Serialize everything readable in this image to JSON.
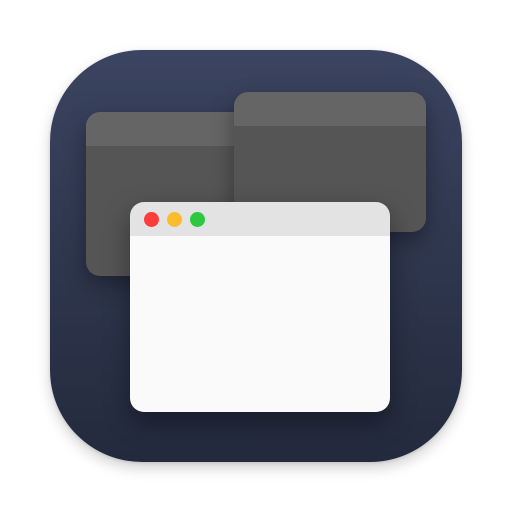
{
  "icon": {
    "semantic": "window-manager-app-icon",
    "colors": {
      "background_top": "#3b4460",
      "background_bottom": "#232a3d",
      "back_window_titlebar": "#656565",
      "back_window_body": "#555555",
      "front_window_titlebar": "#e3e3e3",
      "front_window_body": "#fafafa",
      "traffic_close": "#fc3d39",
      "traffic_minimize": "#fdbc2e",
      "traffic_zoom": "#2bc840"
    }
  }
}
